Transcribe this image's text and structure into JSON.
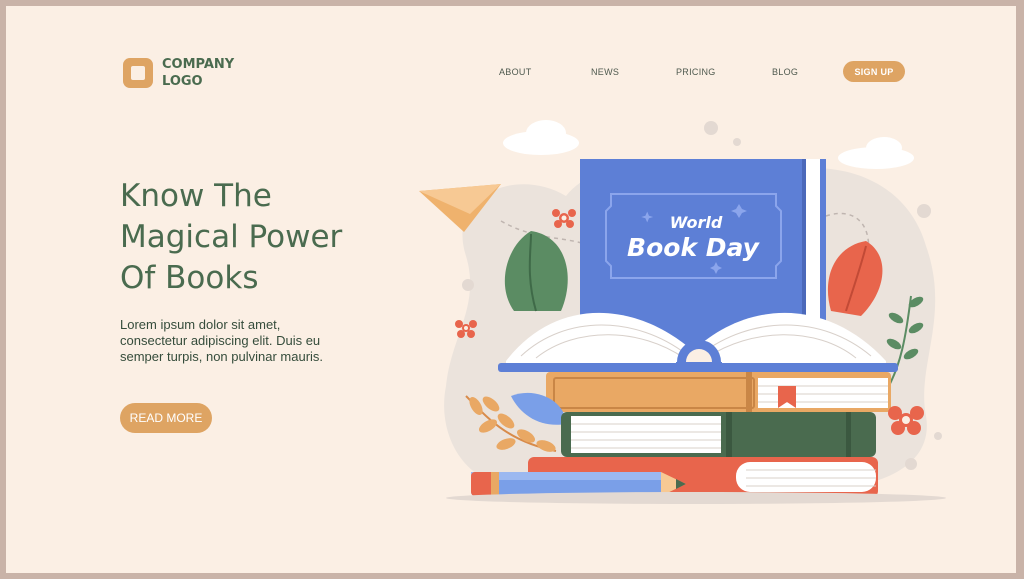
{
  "logo": {
    "line1": "COMPANY",
    "line2": "LOGO",
    "icon": "square-logo-icon"
  },
  "nav": {
    "items": [
      {
        "label": "ABOUT"
      },
      {
        "label": "NEWS"
      },
      {
        "label": "PRICING"
      },
      {
        "label": "BLOG"
      }
    ],
    "signup_label": "SIGN UP"
  },
  "hero": {
    "title_lines": [
      "Know The",
      "Magical Power",
      "Of Books"
    ],
    "body_lines": [
      "Lorem ipsum dolor sit amet,",
      "consectetur adipiscing elit. Duis eu",
      "semper turpis, non pulvinar mauris."
    ],
    "cta_label": "READ MORE"
  },
  "illustration": {
    "book_cover_line1": "World",
    "book_cover_line2": "Book Day"
  },
  "colors": {
    "accent": "#dea463",
    "heading": "#4a6b4f",
    "background": "#fbefe4",
    "book_blue": "#5d7fd6"
  }
}
